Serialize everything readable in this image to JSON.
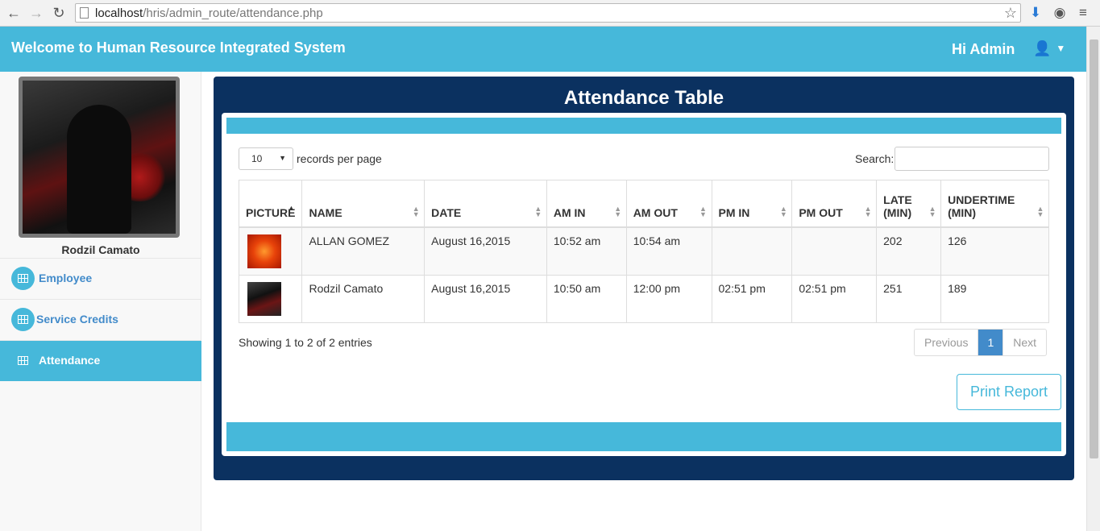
{
  "browser": {
    "url_host": "localhost",
    "url_path": "/hris/admin_route/attendance.php"
  },
  "topbar": {
    "title": "Welcome to Human Resource Integrated System",
    "greeting": "Hi Admin",
    "accent_color": "#46b8da"
  },
  "sidebar": {
    "profile_name": "Rodzil Camato",
    "items": [
      {
        "label": "Employee",
        "icon": "table-icon"
      },
      {
        "label": "Service Credits",
        "icon": "table-icon"
      },
      {
        "label": "Attendance",
        "icon": "table-icon",
        "active": true
      }
    ]
  },
  "main": {
    "title": "Attendance Table",
    "length_value": "10",
    "length_label": "records per page",
    "search_label": "Search:",
    "search_value": "",
    "columns": [
      "PICTURE",
      "NAME",
      "DATE",
      "AM IN",
      "AM OUT",
      "PM IN",
      "PM OUT",
      "LATE (MIN)",
      "UNDERTIME (MIN)"
    ],
    "rows": [
      {
        "picture": "flower-photo",
        "name": "ALLAN GOMEZ",
        "date": "August 16,2015",
        "am_in": "10:52 am",
        "am_out": "10:54 am",
        "pm_in": "",
        "pm_out": "",
        "late": "202",
        "undertime": "126"
      },
      {
        "picture": "user-photo",
        "name": "Rodzil Camato",
        "date": "August 16,2015",
        "am_in": "10:50 am",
        "am_out": "12:00 pm",
        "pm_in": "02:51 pm",
        "pm_out": "02:51 pm",
        "late": "251",
        "undertime": "189"
      }
    ],
    "info": "Showing 1 to 2 of 2 entries",
    "pager": {
      "previous": "Previous",
      "current": "1",
      "next": "Next"
    },
    "print_label": "Print Report",
    "panel_color": "#0b3160"
  }
}
